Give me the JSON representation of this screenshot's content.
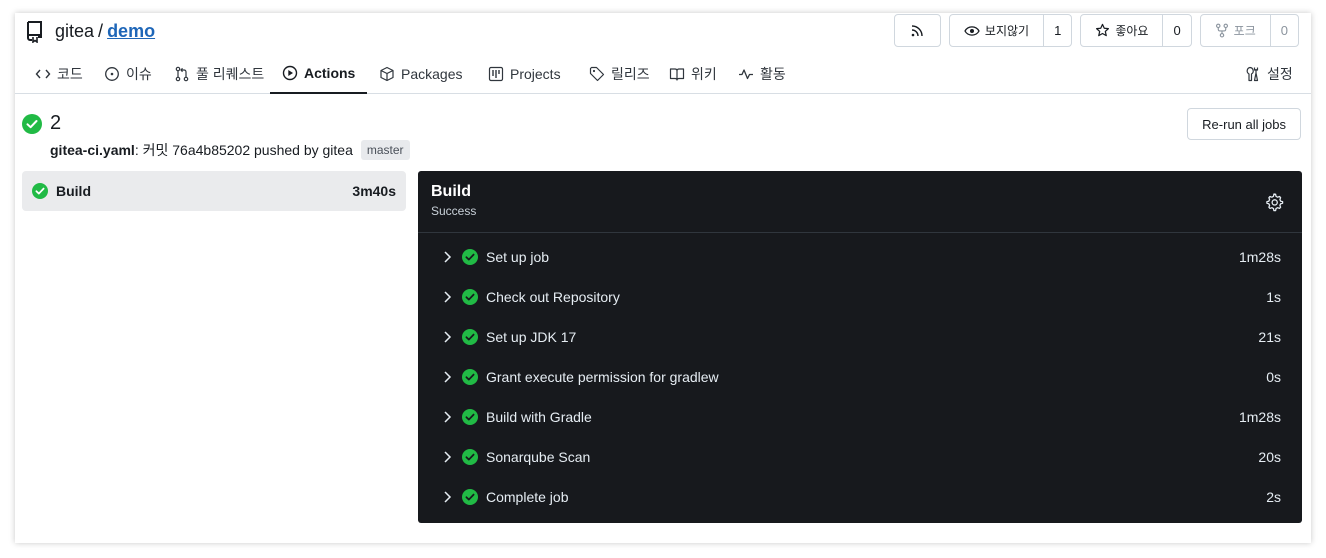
{
  "repo": {
    "owner": "gitea",
    "separator": "/",
    "name": "demo"
  },
  "header_buttons": {
    "watch_label": "보지않기",
    "watch_count": "1",
    "star_label": "좋아요",
    "star_count": "0",
    "fork_label": "포크",
    "fork_count": "0"
  },
  "tabs": [
    {
      "label": "코드",
      "icon": "code-icon"
    },
    {
      "label": "이슈",
      "icon": "issue-icon"
    },
    {
      "label": "풀 리퀘스트",
      "icon": "pull-request-icon"
    },
    {
      "label": "Actions",
      "icon": "play-icon",
      "active": true
    },
    {
      "label": "Packages",
      "icon": "package-icon"
    },
    {
      "label": "Projects",
      "icon": "project-icon"
    },
    {
      "label": "릴리즈",
      "icon": "tag-icon"
    },
    {
      "label": "위키",
      "icon": "book-icon"
    },
    {
      "label": "활동",
      "icon": "pulse-icon"
    },
    {
      "label": "설정",
      "icon": "tools-icon"
    }
  ],
  "run": {
    "number": "2",
    "workflow": "gitea-ci.yaml",
    "meta_text": ": 커밋 76a4b85202 pushed by gitea",
    "branch": "master",
    "rerun_label": "Re-run all jobs"
  },
  "jobs": [
    {
      "name": "Build",
      "duration": "3m40s",
      "status": "success"
    }
  ],
  "panel": {
    "title": "Build",
    "status": "Success",
    "steps": [
      {
        "name": "Set up job",
        "duration": "1m28s"
      },
      {
        "name": "Check out Repository",
        "duration": "1s"
      },
      {
        "name": "Set up JDK 17",
        "duration": "21s"
      },
      {
        "name": "Grant execute permission for gradlew",
        "duration": "0s"
      },
      {
        "name": "Build with Gradle",
        "duration": "1m28s"
      },
      {
        "name": "Sonarqube Scan",
        "duration": "20s"
      },
      {
        "name": "Complete job",
        "duration": "2s"
      }
    ]
  },
  "colors": {
    "success": "#21ba45",
    "link": "#1e66b8",
    "panel_bg": "#17191d"
  }
}
